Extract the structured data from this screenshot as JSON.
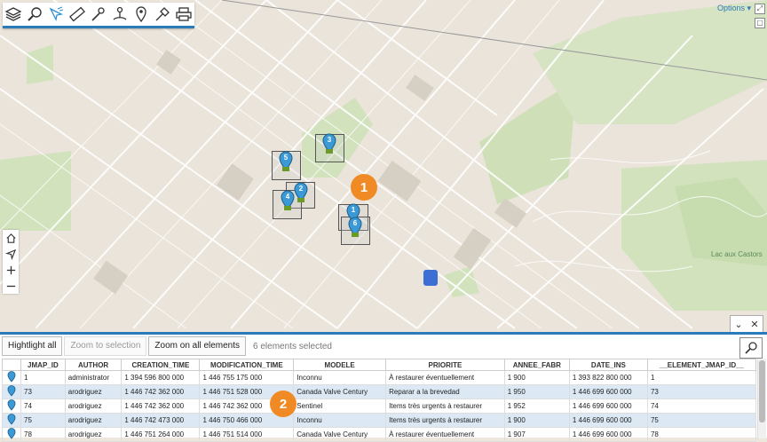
{
  "toolbar": {
    "items": [
      {
        "name": "layers-icon"
      },
      {
        "name": "search-icon"
      },
      {
        "name": "select-tool-icon"
      },
      {
        "name": "measure-icon"
      },
      {
        "name": "edit-icon"
      },
      {
        "name": "route-icon"
      },
      {
        "name": "marker-icon"
      },
      {
        "name": "tools-icon"
      },
      {
        "name": "print-icon"
      }
    ]
  },
  "options_label": "Options ▾",
  "map": {
    "place_label": "Lac aux Castors",
    "callouts": [
      "1",
      "2"
    ],
    "pins": [
      "3",
      "5",
      "2",
      "4",
      "1",
      "6"
    ]
  },
  "panel": {
    "highlight_all": "Hightlight all",
    "zoom_selection": "Zoom to selection",
    "zoom_all": "Zoom on all elements",
    "selected_text": "6 elements selected"
  },
  "table": {
    "headers": [
      "JMAP_ID",
      "AUTHOR",
      "CREATION_TIME",
      "MODIFICATION_TIME",
      "MODELE",
      "PRIORITE",
      "ANNEE_FABR",
      "DATE_INS",
      "__ELEMENT_JMAP_ID__"
    ],
    "rows": [
      [
        "1",
        "administrator",
        "1 394 596 800 000",
        "1 446 755 175 000",
        "Inconnu",
        "À restaurer éventuellement",
        "1 900",
        "1 393 822 800 000",
        "1"
      ],
      [
        "73",
        "arodriguez",
        "1 446 742 362 000",
        "1 446 751 528 000",
        "Canada Valve Century",
        "Reparar a la brevedad",
        "1 950",
        "1 446 699 600 000",
        "73"
      ],
      [
        "74",
        "arodriguez",
        "1 446 742 362 000",
        "1 446 742 362 000",
        "Sentinel",
        "Items très urgents à restaurer",
        "1 952",
        "1 446 699 600 000",
        "74"
      ],
      [
        "75",
        "arodriguez",
        "1 446 742 473 000",
        "1 446 750 466 000",
        "Inconnu",
        "Items très urgents à restaurer",
        "1 900",
        "1 446 699 600 000",
        "75"
      ],
      [
        "78",
        "arodriguez",
        "1 446 751 264 000",
        "1 446 751 514 000",
        "Canada Valve Century",
        "À restaurer éventuellement",
        "1 907",
        "1 446 699 600 000",
        "78"
      ]
    ]
  }
}
